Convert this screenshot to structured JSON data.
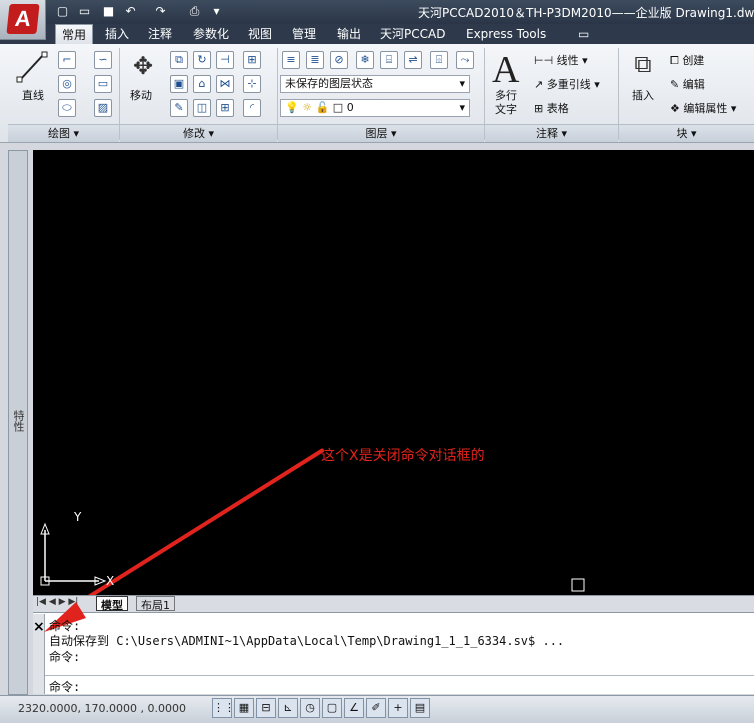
{
  "window": {
    "title": "天河PCCAD2010＆TH-P3DM2010——企业版 Drawing1.dw"
  },
  "quick_access": {
    "icons": [
      "new-icon",
      "open-icon",
      "save-icon",
      "undo-icon",
      "redo-icon",
      "print-icon"
    ]
  },
  "tabs": [
    "常用",
    "插入",
    "注释",
    "参数化",
    "视图",
    "管理",
    "输出",
    "天河PCCAD",
    "Express Tools"
  ],
  "ribbon": {
    "draw": {
      "line_label": "直线",
      "title": "绘图 ▾"
    },
    "modify": {
      "move_label": "移动",
      "title": "修改 ▾"
    },
    "layers": {
      "state_value": "未保存的图层状态",
      "layer_value": "0",
      "title": "图层 ▾"
    },
    "annotation": {
      "mtext_label1": "多行",
      "mtext_label2": "文字",
      "linear_label": "线性",
      "multileader_label": "多重引线",
      "table_label": "表格",
      "title": "注释 ▾"
    },
    "block": {
      "insert_label": "插入",
      "create_label": "创建",
      "edit_label": "编辑",
      "edit_attr_label": "编辑属性",
      "title": "块 ▾"
    }
  },
  "side": {
    "properties_label": "特性"
  },
  "canvas": {
    "annotation_text": "这个X是关闭命令对话框的",
    "ucs_y": "Y",
    "ucs_x": "X",
    "annotation_color": "#e0231c"
  },
  "layout_tabs": {
    "model": "模型",
    "layout1": "布局1"
  },
  "command": {
    "close_glyph": "×",
    "lines": [
      "命令:",
      "自动保存到 C:\\Users\\ADMINI~1\\AppData\\Local\\Temp\\Drawing1_1_1_6334.sv$ ...",
      "命令:"
    ],
    "prompt": "命令:"
  },
  "status": {
    "coords": "2320.0000, 170.0000 , 0.0000"
  }
}
